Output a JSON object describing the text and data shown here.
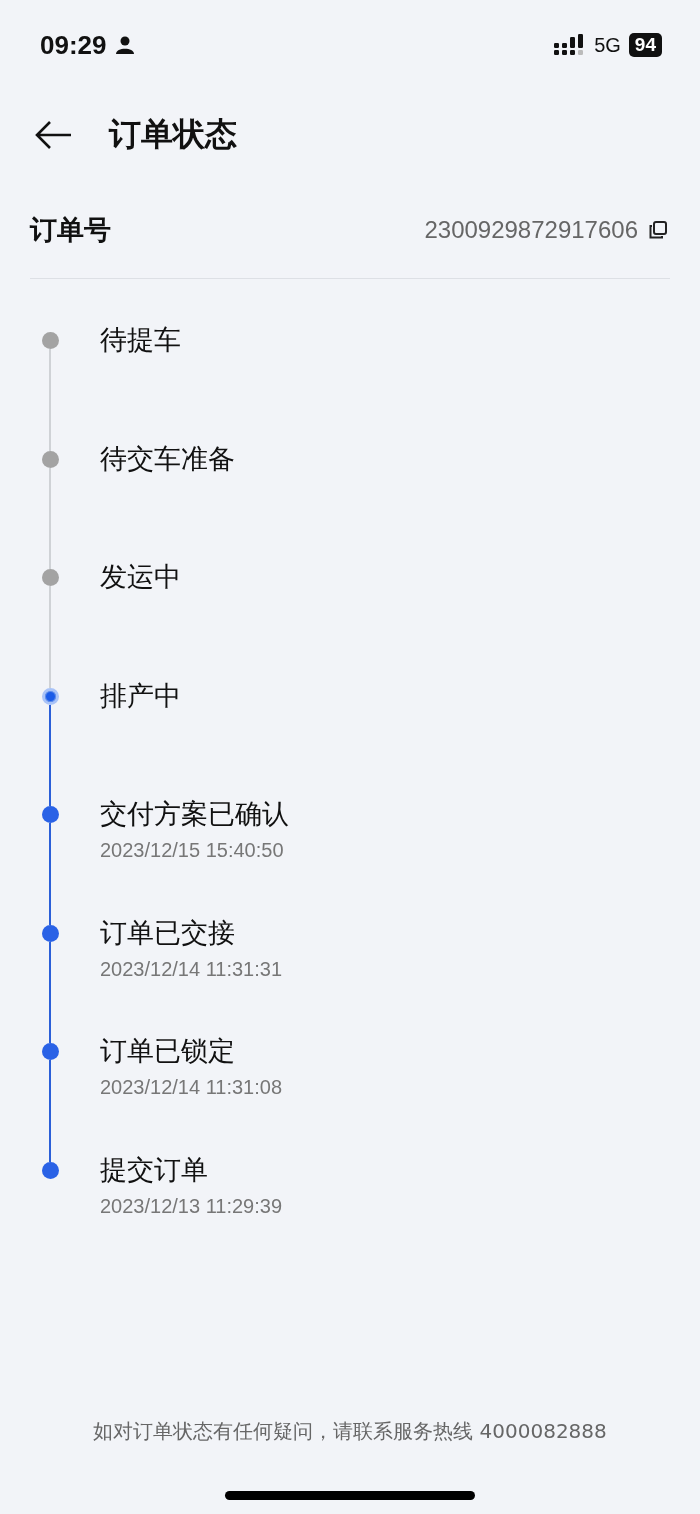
{
  "status_bar": {
    "time": "09:29",
    "network": "5G",
    "battery": "94"
  },
  "header": {
    "title": "订单状态"
  },
  "order": {
    "label": "订单号",
    "number": "2300929872917606"
  },
  "steps": [
    {
      "kind": "pending",
      "title": "待提车"
    },
    {
      "kind": "pending",
      "title": "待交车准备"
    },
    {
      "kind": "pending",
      "title": "发运中"
    },
    {
      "kind": "current",
      "title": "排产中"
    },
    {
      "kind": "done",
      "title": "交付方案已确认",
      "time": "2023/12/15 15:40:50"
    },
    {
      "kind": "done",
      "title": "订单已交接",
      "time": "2023/12/14 11:31:31"
    },
    {
      "kind": "done",
      "title": "订单已锁定",
      "time": "2023/12/14 11:31:08"
    },
    {
      "kind": "done",
      "title": "提交订单",
      "time": "2023/12/13 11:29:39"
    }
  ],
  "footer": {
    "note": "如对订单状态有任何疑问，请联系服务热线 4000082888"
  }
}
